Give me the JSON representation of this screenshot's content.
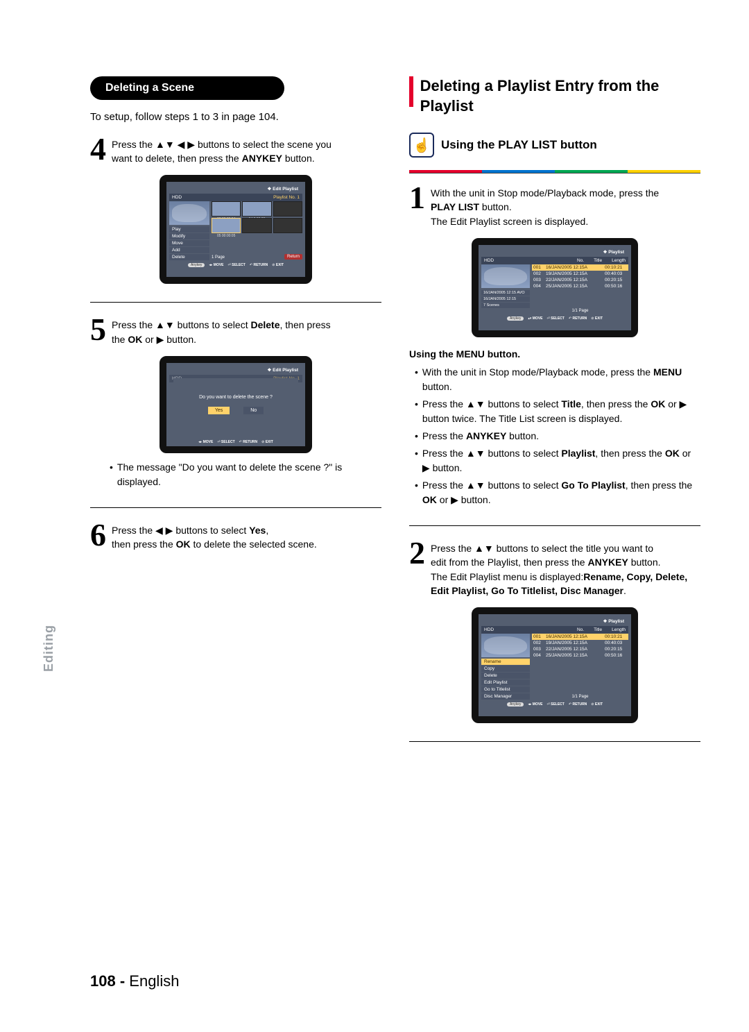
{
  "left": {
    "pill_title": "Deleting a Scene",
    "intro": "To setup, follow steps 1 to 3 in page 104.",
    "step4": {
      "num": "4",
      "line1": "Press the ▲▼ ◀ ▶ buttons to select the scene you",
      "line2": "want to delete, then press the ",
      "bold1": "ANYKEY",
      "line3": " button."
    },
    "step5": {
      "num": "5",
      "line1": "Press the ▲▼ buttons to select ",
      "bold1": "Delete",
      "line2": ", then press",
      "line3": "the ",
      "bold2": "OK",
      "line4": " or ▶ button."
    },
    "confirm_bullet": "The message \"Do you want to delete the scene ?\" is displayed.",
    "step6": {
      "num": "6",
      "line1": "Press the ◀ ▶ buttons to select ",
      "bold1": "Yes",
      "line2": ",",
      "line3": "then press the ",
      "bold2": "OK",
      "line4": " to delete the selected scene."
    },
    "tv1": {
      "title": "Edit Playlist",
      "hdd": "HDD",
      "sub": "Playlist No. 1",
      "menu": [
        "Play",
        "Modify",
        "Move",
        "Add",
        "Delete"
      ],
      "thumbs": [
        "03  00:00:04",
        "04  0:00:03",
        "",
        "05       00:00:05",
        "",
        ""
      ],
      "page": "1 Page",
      "return": "Return"
    },
    "tv2": {
      "title": "Edit Playlist",
      "msg": "Do you want to delete the scene ?",
      "yes": "Yes",
      "no": "No"
    }
  },
  "right": {
    "h2": "Deleting a Playlist Entry from the Playlist",
    "h3": "Using the PLAY LIST button",
    "step1": {
      "num": "1",
      "line1": "With the unit in Stop mode/Playback mode, press the",
      "bold1": "PLAY LIST",
      "line2": " button.",
      "line3": "The Edit Playlist screen is displayed."
    },
    "menu_heading": "Using the MENU button.",
    "bullets": [
      {
        "p": "With the unit in Stop mode/Playback mode, press the ",
        "b": "MENU",
        "s": " button."
      },
      {
        "p": "Press the ▲▼ buttons to select ",
        "b": "Title",
        "s": ", then press the ",
        "b2": "OK",
        "s2": " or ▶ button twice. The Title List screen is displayed."
      },
      {
        "p": "Press the ",
        "b": "ANYKEY",
        "s": " button."
      },
      {
        "p": "Press the ▲▼ buttons to select ",
        "b": "Playlist",
        "s": ", then press the ",
        "b2": "OK",
        "s2": " or ▶ button."
      },
      {
        "p": "Press the ▲▼ buttons to select ",
        "b": "Go To Playlist",
        "s": ", then press the ",
        "b2": "OK",
        "s2": " or ▶ button."
      }
    ],
    "step2": {
      "num": "2",
      "line1": "Press the ▲▼ buttons to select the title you want to",
      "line2": "edit from the Playlist, then press the ",
      "bold1": "ANYKEY",
      "line3": " button.",
      "line4": "The Edit Playlist menu is displayed:",
      "bold_list": "Rename, Copy, Delete, Edit Playlist, Go To Titlelist, Disc Manager"
    },
    "tv3": {
      "title": "Playlist",
      "hdd": "HDD",
      "cols": [
        "No.",
        "Title",
        "Length"
      ],
      "rows": [
        {
          "n": "001",
          "t": "16/JAN/2005 12:15A",
          "l": "00:10:21",
          "sel": true
        },
        {
          "n": "002",
          "t": "19/JAN/2005 12:15A",
          "l": "00:40:03"
        },
        {
          "n": "003",
          "t": "22/JAN/2005 12:15A",
          "l": "00:20:15"
        },
        {
          "n": "004",
          "t": "25/JAN/2005 12:15A",
          "l": "00:50:16"
        }
      ],
      "info1": "16/JAN/2005 12:15 AVO",
      "info2": "16/JAN/2005 12:15",
      "info3": "7 Scenes",
      "page": "1/1 Page"
    },
    "tv4": {
      "title": "Playlist",
      "menu": [
        "Rename",
        "Copy",
        "Delete",
        "Edit Playlist",
        "Go to Titlelist",
        "Disc Manager"
      ],
      "page": "1/1 Page"
    },
    "footer_move": "MOVE",
    "footer_select": "SELECT",
    "footer_return": "RETURN",
    "footer_exit": "EXIT",
    "footer_anykey": "Anykey"
  },
  "tab": "Editing",
  "page_no": "108 -",
  "page_lang": "English"
}
